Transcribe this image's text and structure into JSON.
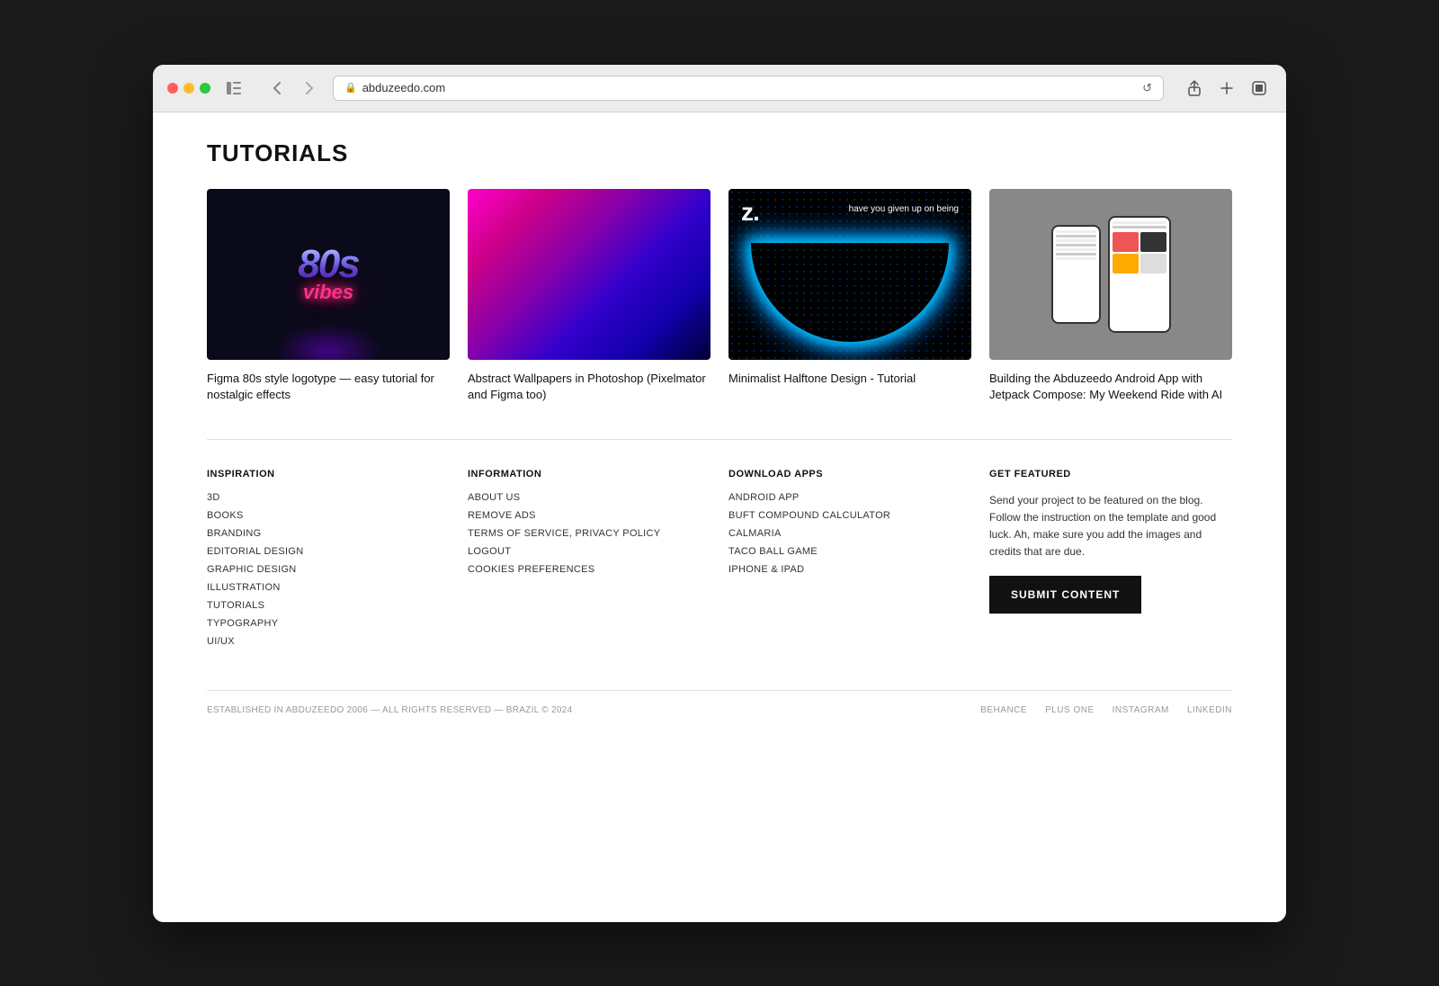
{
  "browser": {
    "url": "abduzeedo.com",
    "back_btn": "‹",
    "forward_btn": "›"
  },
  "page": {
    "title": "TUTORIALS"
  },
  "tutorials": [
    {
      "id": "t1",
      "title": "Figma 80s style logotype — easy tutorial for nostalgic effects",
      "thumb_type": "80s"
    },
    {
      "id": "t2",
      "title": "Abstract Wallpapers in Photoshop (Pixelmator and Figma too)",
      "thumb_type": "gradient"
    },
    {
      "id": "t3",
      "title": "Minimalist Halftone Design - Tutorial",
      "thumb_type": "halftone",
      "halftone_text": "z.",
      "halftone_subtitle": "have you given up on being"
    },
    {
      "id": "t4",
      "title": "Building the Abduzeedo Android App with Jetpack Compose: My Weekend Ride with AI",
      "thumb_type": "android"
    }
  ],
  "footer": {
    "inspiration": {
      "title": "INSPIRATION",
      "links": [
        "3D",
        "BOOKS",
        "BRANDING",
        "EDITORIAL DESIGN",
        "GRAPHIC DESIGN",
        "ILLUSTRATION",
        "TUTORIALS",
        "TYPOGRAPHY",
        "UI/UX"
      ]
    },
    "information": {
      "title": "INFORMATION",
      "links": [
        "ABOUT US",
        "REMOVE ADS",
        "TERMS OF SERVICE, PRIVACY POLICY",
        "LOGOUT",
        "COOKIES PREFERENCES"
      ]
    },
    "download_apps": {
      "title": "DOWNLOAD APPS",
      "links": [
        "ANDROID APP",
        "BUFT COMPOUND CALCULATOR",
        "CALMARIA",
        "TACO BALL GAME",
        "IPHONE & IPAD"
      ]
    },
    "get_featured": {
      "title": "GET FEATURED",
      "description": "Send your project to be featured on the blog. Follow the instruction on the template and good luck. Ah, make sure you add the images and credits that are due.",
      "button_label": "SUBMIT CONTENT"
    }
  },
  "footer_bottom": {
    "copyright": "ESTABLISHED IN ABDUZEEDO 2006 — ALL RIGHTS RESERVED — BRAZIL © 2024",
    "social_links": [
      "BEHANCE",
      "PLUS ONE",
      "INSTAGRAM",
      "LINKEDIN"
    ]
  }
}
